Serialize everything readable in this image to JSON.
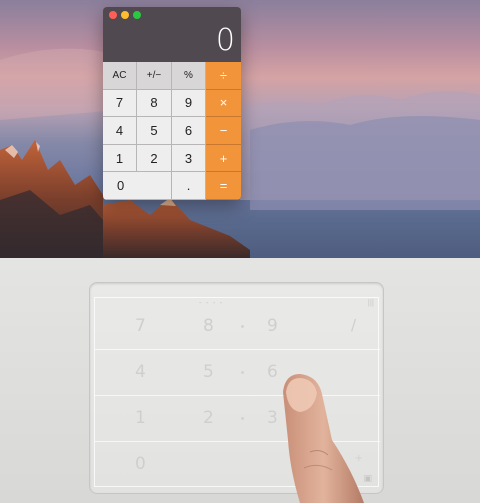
{
  "calculator": {
    "display": "0",
    "keys": [
      {
        "label": "AC",
        "kind": "fn"
      },
      {
        "label": "+/−",
        "kind": "fn"
      },
      {
        "label": "%",
        "kind": "fn"
      },
      {
        "label": "÷",
        "kind": "op"
      },
      {
        "label": "7",
        "kind": "num"
      },
      {
        "label": "8",
        "kind": "num"
      },
      {
        "label": "9",
        "kind": "num"
      },
      {
        "label": "×",
        "kind": "op"
      },
      {
        "label": "4",
        "kind": "num"
      },
      {
        "label": "5",
        "kind": "num"
      },
      {
        "label": "6",
        "kind": "num"
      },
      {
        "label": "−",
        "kind": "op"
      },
      {
        "label": "1",
        "kind": "num"
      },
      {
        "label": "2",
        "kind": "num"
      },
      {
        "label": "3",
        "kind": "num"
      },
      {
        "label": "+",
        "kind": "op"
      },
      {
        "label": "0",
        "kind": "num"
      },
      {
        "label": ".",
        "kind": "num"
      },
      {
        "label": "=",
        "kind": "op"
      }
    ],
    "colors": {
      "body": "#504a50",
      "number_key": "#efeeee",
      "function_key": "#d8d6d6",
      "operator_key": "#f2943a"
    }
  },
  "trackpad_numpad": {
    "rows": [
      {
        "keys": [
          "7",
          "8",
          "9"
        ],
        "symbol": "/"
      },
      {
        "keys": [
          "4",
          "5",
          "6"
        ],
        "symbol": ""
      },
      {
        "keys": [
          "1",
          "2",
          "3"
        ],
        "symbol": ""
      },
      {
        "keys": [
          "0",
          "",
          ""
        ],
        "symbol": "+"
      }
    ]
  }
}
